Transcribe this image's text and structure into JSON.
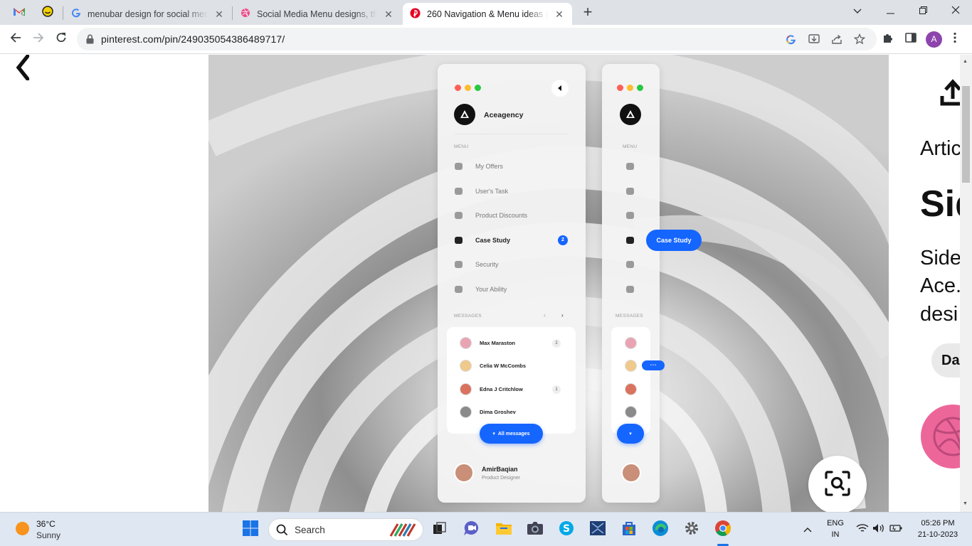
{
  "browser": {
    "tabs": [
      {
        "title": "menubar design for social medi",
        "favicon": "google-icon"
      },
      {
        "title": "Social Media Menu designs, the",
        "favicon": "dribbble-icon"
      },
      {
        "title": "260 Navigation & Menu ideas | ",
        "favicon": "pinterest-icon",
        "active": true
      }
    ],
    "url": "pinterest.com/pin/249035054386489717/",
    "profile_initial": "A"
  },
  "mockup": {
    "brand": "Aceagency",
    "menu_caption": "MENU",
    "menu_items": [
      "My Offers",
      "User's Task",
      "Product Discounts",
      "Case Study",
      "Security",
      "Your Ability"
    ],
    "case_study_badge": "2",
    "messages_caption": "MESSAGES",
    "messages": [
      {
        "name": "Max Maraston",
        "count": "2"
      },
      {
        "name": "Celia W McCombs",
        "count": ""
      },
      {
        "name": "Edna J Critchlow",
        "count": "1"
      },
      {
        "name": "Dima Groshev",
        "count": ""
      }
    ],
    "all_messages": "All messages",
    "user_name": "AmirBaqian",
    "user_role": "Product Designer",
    "tooltip": "Case Study",
    "more": "• • •"
  },
  "right_panel": {
    "line1": "Artic",
    "heading": "Sid",
    "desc1": "Side",
    "desc2": "Ace.",
    "desc3": "desi",
    "chip": "Da"
  },
  "taskbar": {
    "temperature": "36°C",
    "weather": "Sunny",
    "search": "Search",
    "lang1": "ENG",
    "lang2": "IN",
    "time": "05:26 PM",
    "date": "21-10-2023"
  },
  "colors": {
    "accent_blue": "#1565ff",
    "profile": "#8e44ad",
    "pinterest": "#e60023"
  }
}
